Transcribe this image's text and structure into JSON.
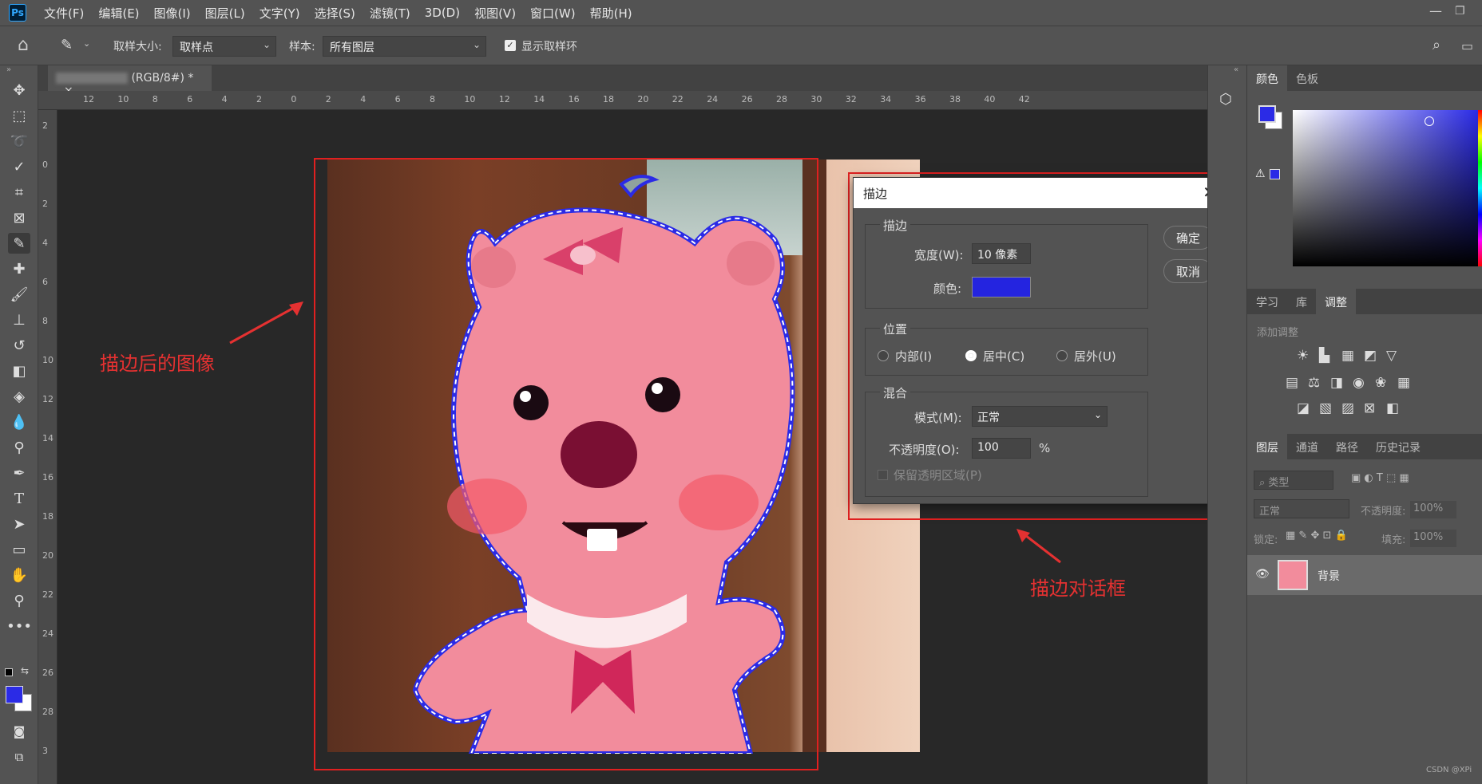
{
  "app": {
    "logo": "Ps"
  },
  "menu": [
    "文件(F)",
    "编辑(E)",
    "图像(I)",
    "图层(L)",
    "文字(Y)",
    "选择(S)",
    "滤镜(T)",
    "3D(D)",
    "视图(V)",
    "窗口(W)",
    "帮助(H)"
  ],
  "options": {
    "sample_size_label": "取样大小:",
    "sample_size_value": "取样点",
    "sample_label": "样本:",
    "sample_value": "所有图层",
    "show_ring_label": "显示取样环"
  },
  "document": {
    "tab_label": "(RGB/8#) *",
    "close": "×"
  },
  "ruler": {
    "top": [
      "12",
      "10",
      "8",
      "6",
      "4",
      "2",
      "0",
      "2",
      "4",
      "6",
      "8",
      "10",
      "12",
      "14",
      "16",
      "18",
      "20",
      "22",
      "24",
      "26",
      "28",
      "30",
      "32",
      "34",
      "36",
      "38",
      "40",
      "42"
    ],
    "left": [
      "2",
      "0",
      "2",
      "4",
      "6",
      "8",
      "10",
      "12",
      "14",
      "16",
      "18",
      "20",
      "22",
      "24",
      "26",
      "28",
      "3"
    ]
  },
  "annotations": {
    "image_label": "描边后的图像",
    "dialog_label": "描边对话框"
  },
  "dialog": {
    "title": "描边",
    "stroke_group": "描边",
    "width_label": "宽度(W):",
    "width_value": "10 像素",
    "color_label": "颜色:",
    "stroke_color": "#2424e0",
    "position_group": "位置",
    "inside": "内部(I)",
    "center": "居中(C)",
    "outside": "居外(U)",
    "blend_group": "混合",
    "mode_label": "模式(M):",
    "mode_value": "正常",
    "opacity_label": "不透明度(O):",
    "opacity_value": "100",
    "opacity_unit": "%",
    "preserve_label": "保留透明区域(P)",
    "ok": "确定",
    "cancel": "取消"
  },
  "panels": {
    "color_tabs": [
      "颜色",
      "色板"
    ],
    "adjust_tabs": [
      "学习",
      "库",
      "调整"
    ],
    "add_adjust": "添加调整",
    "layer_tabs": [
      "图层",
      "通道",
      "路径",
      "历史记录"
    ],
    "filter_label": "类型",
    "blend_mode": "正常",
    "opacity_label": "不透明度:",
    "opacity_value": "100%",
    "lock_label": "锁定:",
    "fill_label": "填充:",
    "fill_value": "100%",
    "layer_name": "背景"
  },
  "watermark": "CSDN @XPi",
  "colors": {
    "foreground": "#2b2be6",
    "annotation": "#e53131"
  }
}
